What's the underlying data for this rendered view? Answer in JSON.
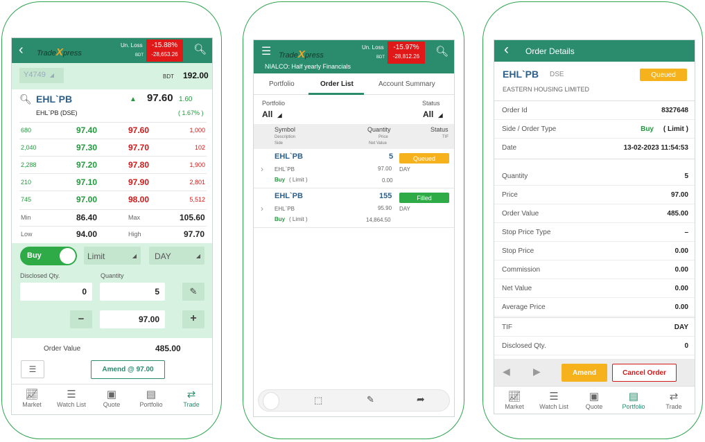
{
  "brand": {
    "logo_main": "Trade",
    "logo_x": "X",
    "logo_tail": "press"
  },
  "nav": [
    "Market",
    "Watch List",
    "Quote",
    "Portfolio",
    "Trade"
  ],
  "s1": {
    "unloss_label": "Un. Loss",
    "unloss_pct": "-15.88%",
    "bdt": "BDT",
    "unloss_amt": "-28,653.26",
    "account": "Y4749",
    "bal_bdt": "BDT",
    "balance": "192.00",
    "symbol": "EHL`PB",
    "last_price": "97.60",
    "change": "1.60",
    "sub": "EHL`PB (DSE)",
    "change_pct": "( 1.67% )",
    "depth": [
      {
        "bq": "680",
        "bp": "97.40",
        "ap": "97.60",
        "aq": "1,000"
      },
      {
        "bq": "2,040",
        "bp": "97.30",
        "ap": "97.70",
        "aq": "102"
      },
      {
        "bq": "2,288",
        "bp": "97.20",
        "ap": "97.80",
        "aq": "1,900"
      },
      {
        "bq": "210",
        "bp": "97.10",
        "ap": "97.90",
        "aq": "2,801"
      },
      {
        "bq": "745",
        "bp": "97.00",
        "ap": "98.00",
        "aq": "5,512"
      }
    ],
    "min_label": "Min",
    "min": "86.40",
    "max_label": "Max",
    "max": "105.60",
    "low_label": "Low",
    "low": "94.00",
    "high_label": "High",
    "high": "97.70",
    "side": "Buy",
    "order_type": "Limit",
    "tif": "DAY",
    "disclosed_label": "Disclosed Qty.",
    "quantity_label": "Quantity",
    "disclosed_value": "0",
    "quantity_value": "5",
    "price_value": "97.00",
    "minus": "−",
    "plus": "+",
    "order_value_label": "Order Value",
    "order_value": "485.00",
    "amend_button": "Amend @ 97.00"
  },
  "s2": {
    "unloss_label": "Un. Loss",
    "unloss_pct": "-15.97%",
    "bdt": "BDT",
    "unloss_amt": "-28,812.26",
    "news": "NIALCO: Half yearly Financials",
    "tabs": [
      "Portfolio",
      "Order List",
      "Account Summary"
    ],
    "portfolio_label": "Portfolio",
    "portfolio_value": "All",
    "status_label": "Status",
    "status_value": "All",
    "headers": {
      "symbol": "Symbol",
      "description": "Description",
      "side": "Side",
      "quantity": "Quantity",
      "price": "Price",
      "net_value": "Net Value",
      "status": "Status",
      "tif": "TIF"
    },
    "orders": [
      {
        "symbol": "EHL`PB",
        "desc": "EHL`PB",
        "side": "Buy",
        "type": "( Limit )",
        "qty": "5",
        "price": "97.00",
        "net": "0.00",
        "status": "Queued",
        "tif": "DAY"
      },
      {
        "symbol": "EHL`PB",
        "desc": "EHL`PB",
        "side": "Buy",
        "type": "( Limit )",
        "qty": "155",
        "price": "95.90",
        "net": "14,864.50",
        "status": "Filled",
        "tif": "DAY"
      }
    ]
  },
  "s3": {
    "title": "Order Details",
    "symbol": "EHL`PB",
    "exchange": "DSE",
    "status": "Queued",
    "company": "EASTERN HOUSING LIMITED",
    "side_label": "Side  /  Order Type",
    "side": "Buy",
    "order_type": "( Limit )",
    "rows_top": [
      {
        "label": "Order Id",
        "value": "8327648"
      },
      {
        "label": "Date",
        "value": "13-02-2023 11:54:53"
      }
    ],
    "rows": [
      {
        "label": "Quantity",
        "value": "5"
      },
      {
        "label": "Price",
        "value": "97.00"
      },
      {
        "label": "Order Value",
        "value": "485.00"
      },
      {
        "label": "Stop Price Type",
        "value": "–"
      },
      {
        "label": "Stop Price",
        "value": "0.00"
      },
      {
        "label": "Commission",
        "value": "0.00"
      },
      {
        "label": "Net Value",
        "value": "0.00"
      },
      {
        "label": "Average Price",
        "value": "0.00"
      }
    ],
    "rows_bottom": [
      {
        "label": "TIF",
        "value": "DAY"
      },
      {
        "label": "Disclosed Qty.",
        "value": "0"
      }
    ],
    "amend": "Amend",
    "cancel": "Cancel Order"
  }
}
